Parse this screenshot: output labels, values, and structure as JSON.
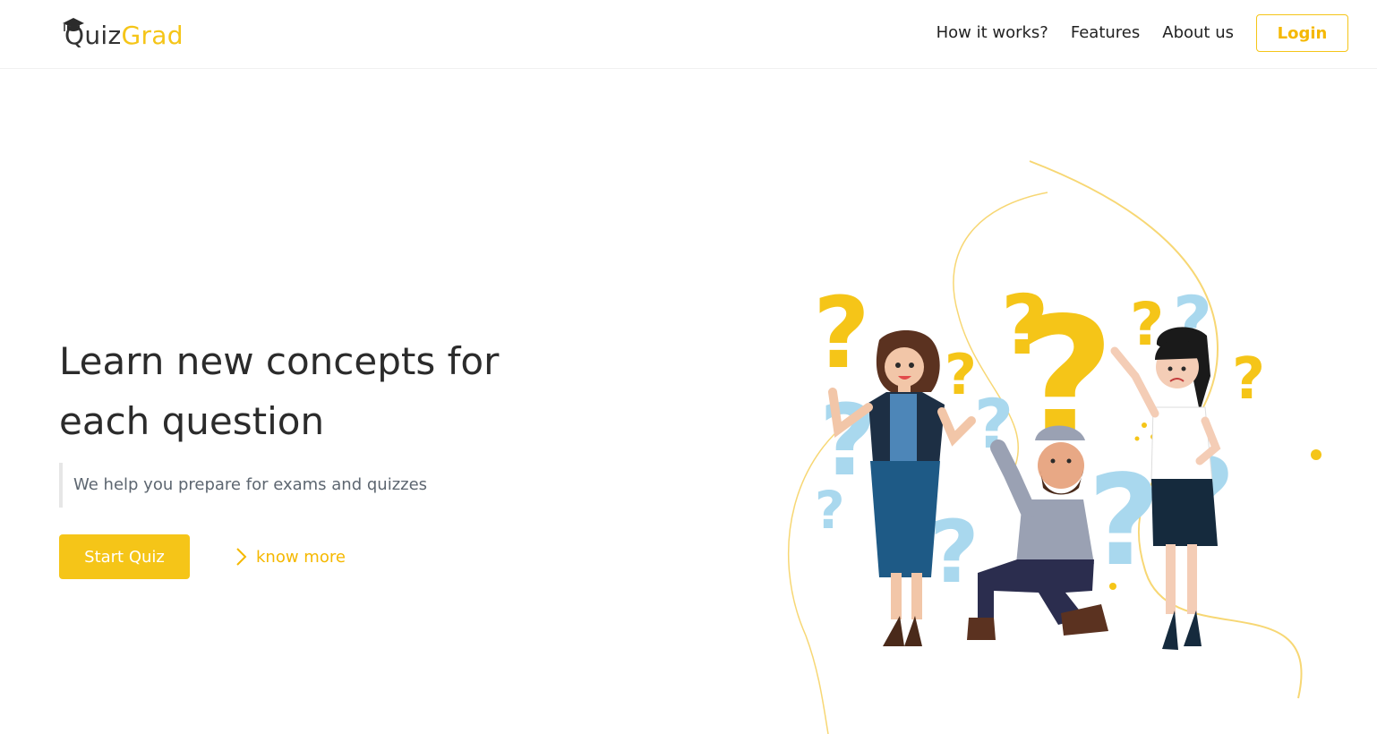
{
  "brand": {
    "name_part1": "Quiz",
    "name_part2": "Grad",
    "primary_color": "#f5c518",
    "text_color": "#333333"
  },
  "nav": {
    "links": [
      {
        "label": "How it works?"
      },
      {
        "label": "Features"
      },
      {
        "label": "About us"
      }
    ],
    "login_label": "Login"
  },
  "hero": {
    "title_line1": "Learn new concepts for",
    "title_line2": "each question",
    "subtitle": "We help you prepare for exams and quizzes",
    "start_button": "Start Quiz",
    "know_more": "know more"
  },
  "illustration": {
    "icon": "people-with-question-marks-illustration",
    "colors": {
      "yellow": "#f5c518",
      "light_blue": "#a9d8ee"
    }
  }
}
